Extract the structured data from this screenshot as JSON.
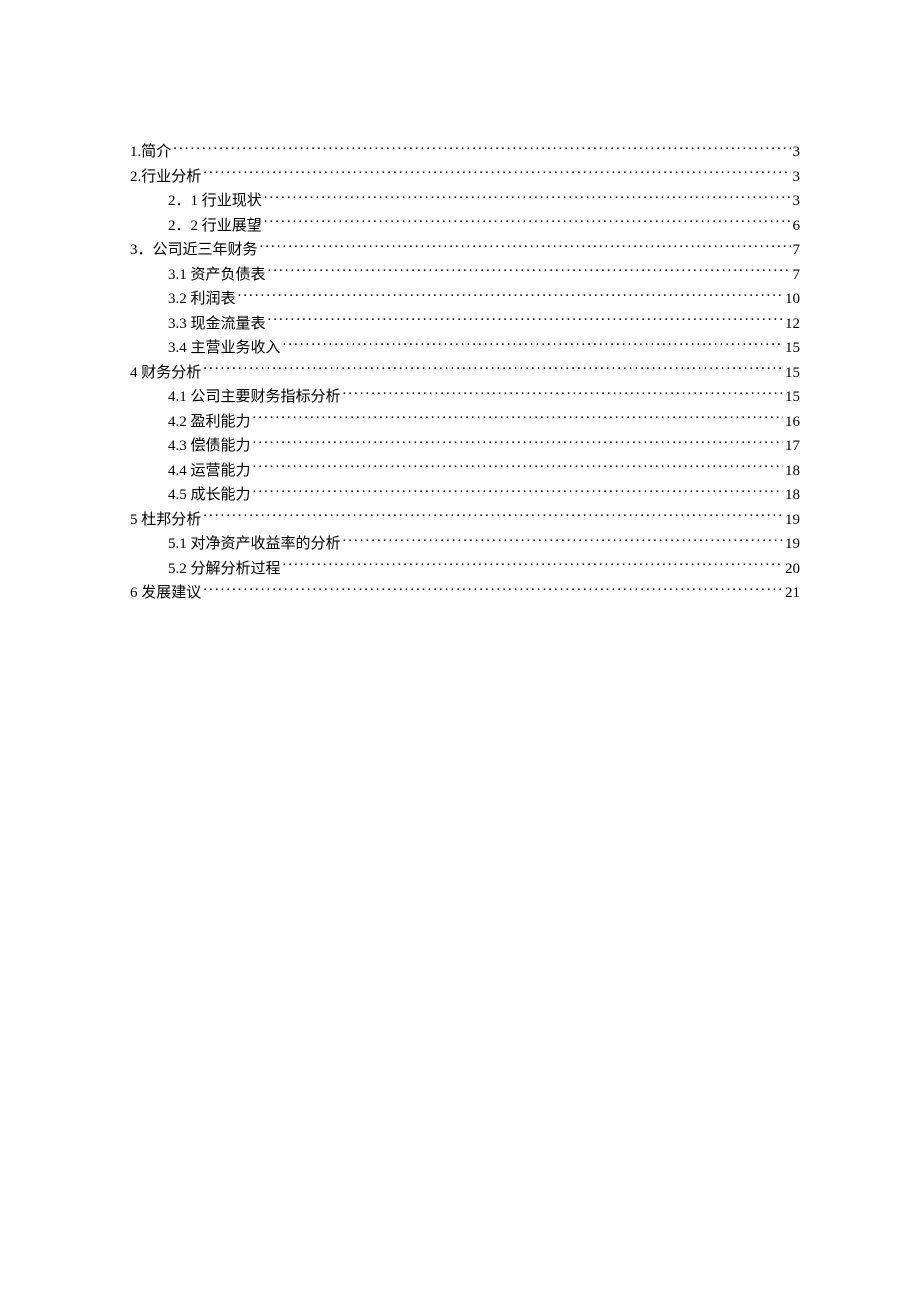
{
  "toc": [
    {
      "level": 1,
      "label": "1.简介",
      "page": "3"
    },
    {
      "level": 1,
      "label": "2.行业分析",
      "page": "3"
    },
    {
      "level": 2,
      "label": "2．1 行业现状",
      "page": "3"
    },
    {
      "level": 2,
      "label": "2．2 行业展望",
      "page": "6"
    },
    {
      "level": 1,
      "label": "3．公司近三年财务",
      "page": "7"
    },
    {
      "level": 2,
      "label": "3.1 资产负债表",
      "page": "7"
    },
    {
      "level": 2,
      "label": "3.2 利润表",
      "page": "10"
    },
    {
      "level": 2,
      "label": "3.3 现金流量表",
      "page": "12"
    },
    {
      "level": 2,
      "label": "3.4 主营业务收入",
      "page": "15"
    },
    {
      "level": 1,
      "label": "4 财务分析",
      "page": "15"
    },
    {
      "level": 2,
      "label": "4.1 公司主要财务指标分析",
      "page": "15"
    },
    {
      "level": 2,
      "label": "4.2  盈利能力",
      "page": "16"
    },
    {
      "level": 2,
      "label": "4.3  偿债能力",
      "page": "17"
    },
    {
      "level": 2,
      "label": "4.4  运营能力",
      "page": "18"
    },
    {
      "level": 2,
      "label": "4.5  成长能力",
      "page": "18"
    },
    {
      "level": 1,
      "label": "5 杜邦分析",
      "page": "19"
    },
    {
      "level": 2,
      "label": "5.1 对净资产收益率的分析",
      "page": "19"
    },
    {
      "level": 2,
      "label": "5.2 分解分析过程",
      "page": "20"
    },
    {
      "level": 1,
      "label": "6 发展建议",
      "page": "21"
    }
  ]
}
